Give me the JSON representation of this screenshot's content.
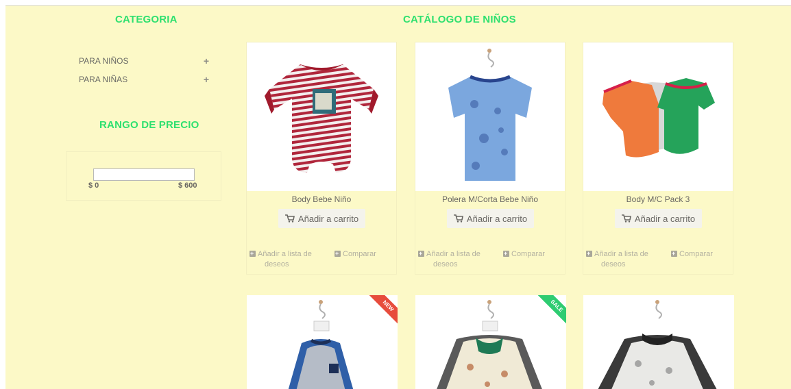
{
  "sidebar": {
    "category_heading": "CATEGORIA",
    "categories": [
      {
        "label": "PARA NIÑOS"
      },
      {
        "label": "PARA NIÑAS"
      }
    ],
    "price_heading": "RANGO DE PRECIO",
    "price_min": "$ 0",
    "price_max": "$ 600"
  },
  "catalog": {
    "heading": "CATÁLOGO DE NIÑOS",
    "products": [
      {
        "name": "Body Bebe Niño",
        "cart_label": "Añadir a carrito",
        "wish_label_1": "Añadir a lista de",
        "wish_label_2": "deseos",
        "compare_label": "Comparar",
        "image": "striped-baby-body"
      },
      {
        "name": "Polera M/Corta Bebe Niño",
        "cart_label": "Añadir a carrito",
        "wish_label_1": "Añadir a lista de",
        "wish_label_2": "deseos",
        "compare_label": "Comparar",
        "image": "blue-printed-tshirt"
      },
      {
        "name": "Body M/C Pack 3",
        "cart_label": "Añadir a carrito",
        "wish_label_1": "Añadir a lista de",
        "wish_label_2": "deseos",
        "compare_label": "Comparar",
        "image": "body-pack-3"
      }
    ],
    "second_row": [
      {
        "badge": "NEW",
        "badge_color": "#e74c3c",
        "image": "long-sleeve-set-blue"
      },
      {
        "badge": "SALE",
        "badge_color": "#2ecc71",
        "image": "long-sleeve-set-print"
      },
      {
        "badge": "",
        "badge_color": "",
        "image": "long-sleeve-set-grey"
      }
    ]
  },
  "colors": {
    "accent": "#2ee06f",
    "background": "#fcf9c7"
  }
}
